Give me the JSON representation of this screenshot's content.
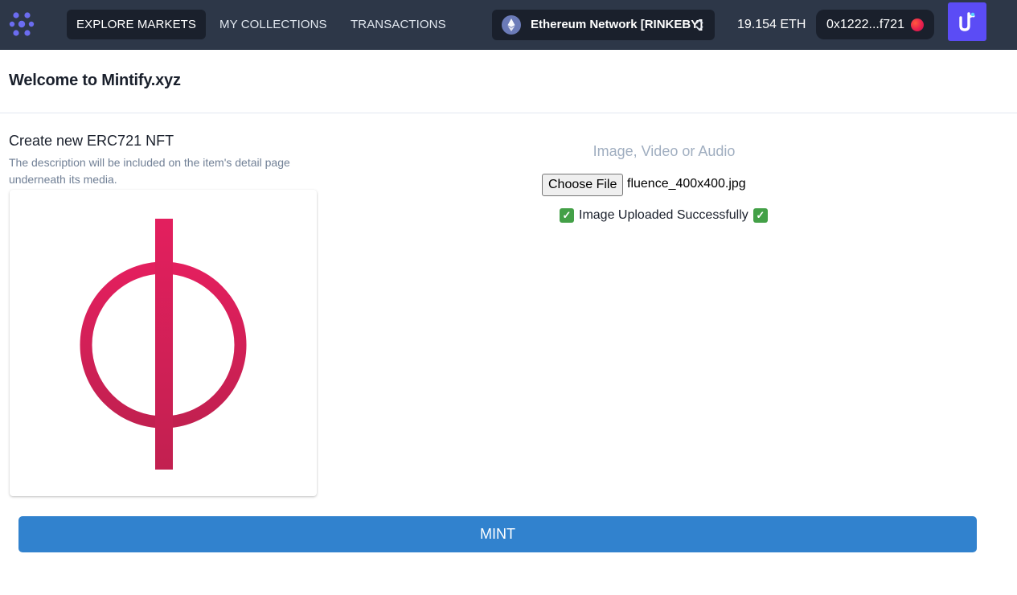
{
  "nav": {
    "tabs": [
      {
        "label": "EXPLORE MARKETS",
        "active": true
      },
      {
        "label": "MY COLLECTIONS",
        "active": false
      },
      {
        "label": "TRANSACTIONS",
        "active": false
      }
    ],
    "network": {
      "label": "Ethereum Network [RINKEBY]",
      "icon": "ethereum-icon"
    },
    "balance": "19.154 ETH",
    "account": {
      "address": "0x1222...f721"
    },
    "app_button_icon": "app-logo-icon"
  },
  "page": {
    "title": "Welcome to Mintify.xyz"
  },
  "form": {
    "title": "Create new ERC721 NFT",
    "description": "The description will be included on the item's detail page underneath its media.",
    "media_label": "Image, Video or Audio",
    "file_button": "Choose File",
    "file_name": "fluence_400x400.jpg",
    "file_name_shown": "fluence_400x400.jpg",
    "upload_status": "Image Uploaded Successfully",
    "mint_label": "MINT"
  },
  "colors": {
    "nav_bg": "#2d3748",
    "accent": "#3182ce",
    "nft_pink": "#e0215e",
    "app_button": "#5b4cf5"
  }
}
